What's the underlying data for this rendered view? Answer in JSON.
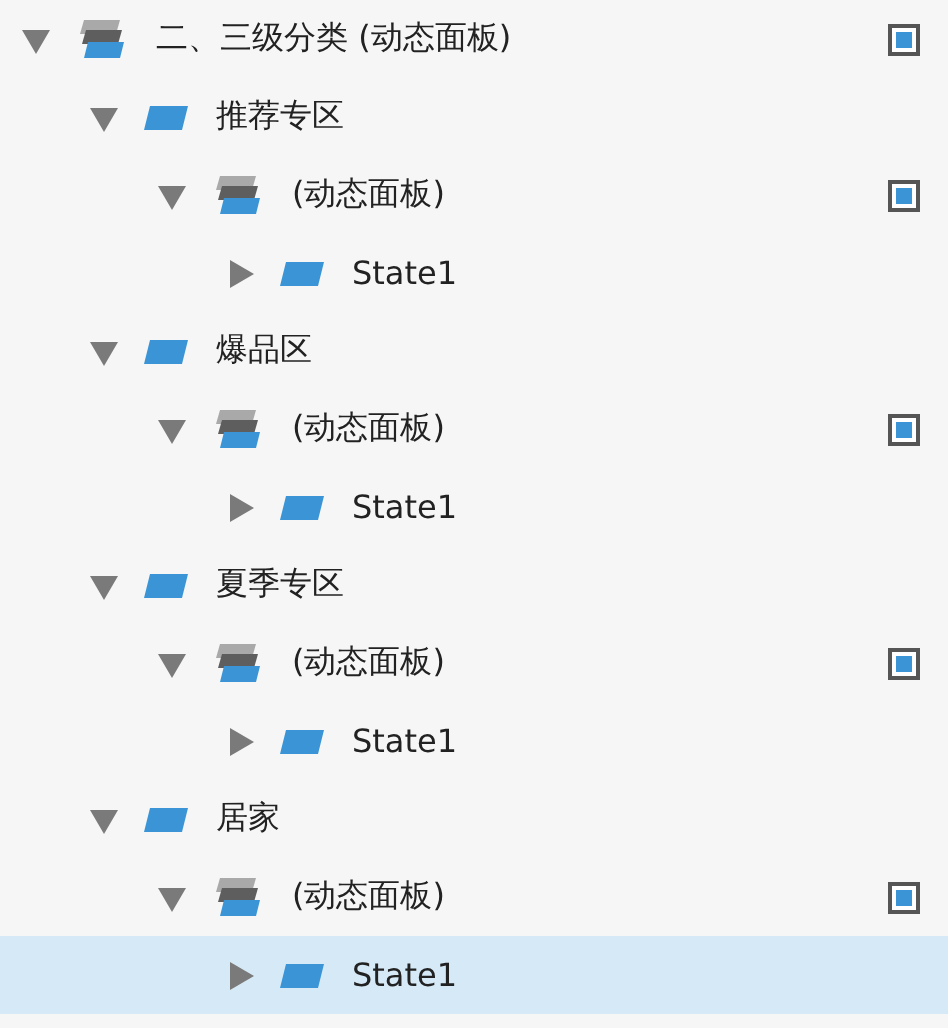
{
  "outline": [
    {
      "label": "二、三级分类 (动态面板)",
      "kind": "panel",
      "expanded": true,
      "selected": false,
      "visible": true,
      "children": [
        {
          "label": "推荐专区",
          "kind": "state",
          "expanded": true,
          "selected": false,
          "children": [
            {
              "label": "(动态面板)",
              "kind": "panel",
              "expanded": true,
              "selected": false,
              "visible": true,
              "children": [
                {
                  "label": "State1",
                  "kind": "state",
                  "expanded": false,
                  "selected": false
                }
              ]
            }
          ]
        },
        {
          "label": "爆品区",
          "kind": "state",
          "expanded": true,
          "selected": false,
          "children": [
            {
              "label": "(动态面板)",
              "kind": "panel",
              "expanded": true,
              "selected": false,
              "visible": true,
              "children": [
                {
                  "label": "State1",
                  "kind": "state",
                  "expanded": false,
                  "selected": false
                }
              ]
            }
          ]
        },
        {
          "label": "夏季专区",
          "kind": "state",
          "expanded": true,
          "selected": false,
          "children": [
            {
              "label": "(动态面板)",
              "kind": "panel",
              "expanded": true,
              "selected": false,
              "visible": true,
              "children": [
                {
                  "label": "State1",
                  "kind": "state",
                  "expanded": false,
                  "selected": false
                }
              ]
            }
          ]
        },
        {
          "label": "居家",
          "kind": "state",
          "expanded": true,
          "selected": false,
          "children": [
            {
              "label": "(动态面板)",
              "kind": "panel",
              "expanded": true,
              "selected": false,
              "visible": true,
              "children": [
                {
                  "label": "State1",
                  "kind": "state",
                  "expanded": false,
                  "selected": true
                }
              ]
            }
          ]
        }
      ]
    }
  ]
}
